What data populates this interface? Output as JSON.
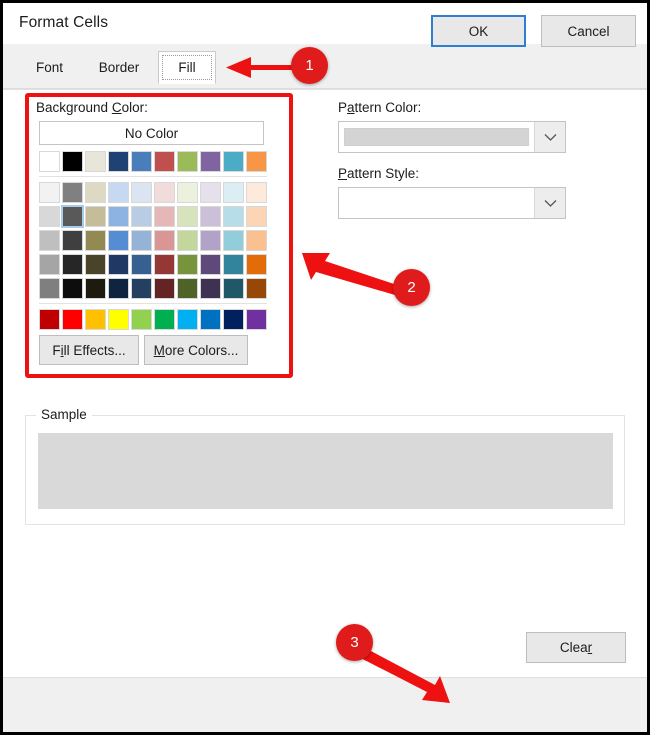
{
  "window": {
    "title": "Format Cells",
    "help_icon": "?",
    "close_icon": "close-icon"
  },
  "tabs": [
    {
      "id": "font",
      "label": "Font",
      "active": false
    },
    {
      "id": "border",
      "label": "Border",
      "active": false
    },
    {
      "id": "fill",
      "label": "Fill",
      "active": true
    }
  ],
  "background_color": {
    "label": "Background Color:",
    "label_prefix": "Background ",
    "label_accel": "C",
    "label_suffix": "olor:",
    "no_color_label": "No Color",
    "selected_index": [
      1,
      1
    ],
    "theme_colors": [
      "#ffffff",
      "#000000",
      "#e8e5d9",
      "#1f4173",
      "#4a7ebb",
      "#c0504d",
      "#9bbb59",
      "#8064a2",
      "#4bacc6",
      "#f79646"
    ],
    "tint_rows": [
      [
        "#f2f2f2",
        "#808080",
        "#ddd9c3",
        "#c6d9f0",
        "#dbe5f1",
        "#f2dcdb",
        "#ebf1dd",
        "#e5e0ec",
        "#dbeef3",
        "#fdeada"
      ],
      [
        "#d8d8d8",
        "#595959",
        "#c4bd97",
        "#8db3e2",
        "#b8cce4",
        "#e5b8b7",
        "#d7e3bc",
        "#ccc0d9",
        "#b7dde8",
        "#fbd5b5"
      ],
      [
        "#bfbfbf",
        "#3f3f3f",
        "#938953",
        "#548dd4",
        "#95b3d7",
        "#d99694",
        "#c3d69b",
        "#b2a2c7",
        "#92cddc",
        "#fac08f"
      ],
      [
        "#a5a5a5",
        "#262626",
        "#494429",
        "#1f3864",
        "#366092",
        "#953735",
        "#77933c",
        "#5f497a",
        "#31849b",
        "#e36c0a"
      ],
      [
        "#7f7f7f",
        "#0d0d0d",
        "#1d1b10",
        "#0f243e",
        "#244061",
        "#632423",
        "#4f6228",
        "#3f3151",
        "#205867",
        "#984806"
      ]
    ],
    "standard_colors": [
      "#c00000",
      "#ff0000",
      "#ffc000",
      "#ffff00",
      "#92d050",
      "#00b050",
      "#00b0f0",
      "#0070c0",
      "#002060",
      "#7030a0"
    ],
    "fill_effects_label": "Fill Effects...",
    "fill_effects_prefix": "F",
    "fill_effects_accel": "i",
    "fill_effects_suffix": "ll Effects...",
    "more_colors_label": "More Colors...",
    "more_colors_accel": "M",
    "more_colors_suffix": "ore Colors..."
  },
  "pattern_color": {
    "label": "Pattern Color:",
    "label_prefix": "P",
    "label_accel": "a",
    "label_suffix": "ttern Color:",
    "value": "",
    "swatch_color": "#d4d4d4",
    "dropdown_icon": "chevron-down-icon"
  },
  "pattern_style": {
    "label": "Pattern Style:",
    "label_accel": "P",
    "label_suffix": "attern Style:",
    "value": "",
    "dropdown_icon": "chevron-down-icon"
  },
  "sample": {
    "label": "Sample",
    "swatch_color": "#d9d9d9"
  },
  "buttons": {
    "clear_label": "Clear",
    "clear_prefix": "Clea",
    "clear_accel": "r",
    "ok_label": "OK",
    "cancel_label": "Cancel"
  },
  "annotations": {
    "accent_color": "#e01b1b",
    "highlight_color": "#ee1111",
    "markers": [
      {
        "number": "1",
        "target": "fill-tab"
      },
      {
        "number": "2",
        "target": "background-color-group"
      },
      {
        "number": "3",
        "target": "ok-button"
      }
    ]
  }
}
